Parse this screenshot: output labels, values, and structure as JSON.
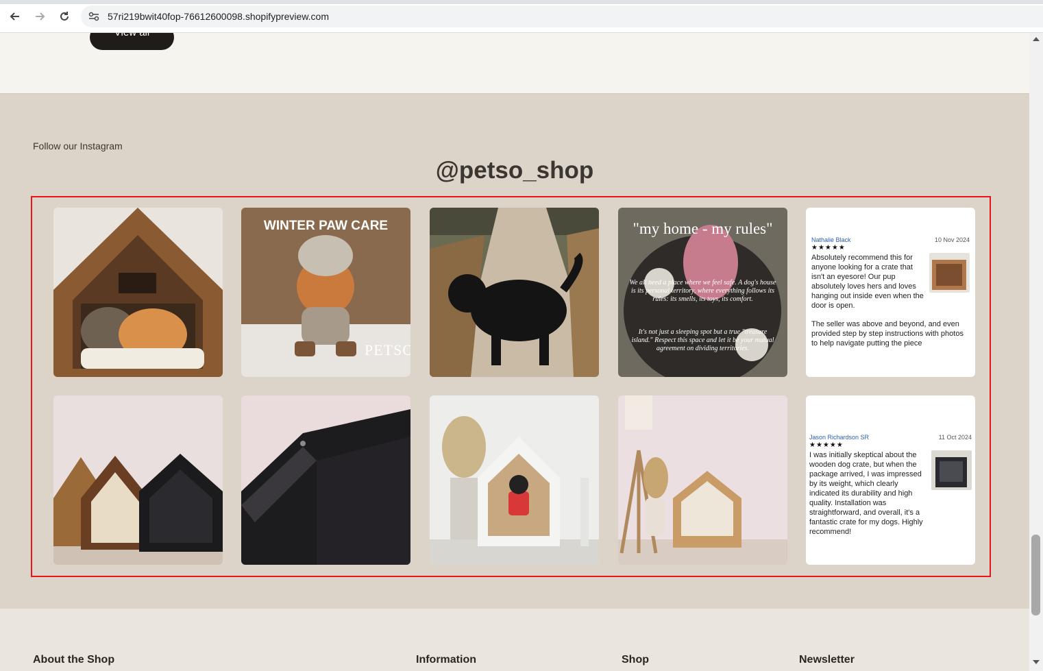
{
  "browser": {
    "url": "57ri219bwit40fop-76612600098.shopifypreview.com"
  },
  "top": {
    "view_all_label": "View all"
  },
  "instagram": {
    "kicker": "Follow our Instagram",
    "handle": "@petso_shop",
    "tiles": [
      {
        "id": "cats-in-house",
        "caption": ""
      },
      {
        "id": "winter-paw-care",
        "caption": "WINTER PAW CARE",
        "watermark": "PETSO"
      },
      {
        "id": "black-dog-path",
        "caption": ""
      },
      {
        "id": "my-home-my-rules",
        "caption": "\"my home - my rules\"",
        "para1": "We all need a place where we feel safe. A dog's house is its personal territory, where everything follows its rules: its smells, its toys, its comfort.",
        "para2": "It's not just a sleeping spot but a true \"treasure island.\" Respect this space and let it be your mutual agreement on dividing territories."
      },
      {
        "id": "houses-trio",
        "caption": ""
      },
      {
        "id": "black-house-closeup",
        "caption": ""
      },
      {
        "id": "white-crate-pug",
        "caption": ""
      },
      {
        "id": "natural-crate-room",
        "caption": ""
      }
    ],
    "reviews": [
      {
        "name": "Nathalie Black",
        "date": "10 Nov 2024",
        "stars": "★★★★★",
        "text": "Absolutely recommend this for anyone looking for a crate that isn't an eyesore! Our pup absolutely loves hers and loves hanging out inside even when the door is open.",
        "more": "The seller was above and beyond, and even provided step by step instructions with photos to help navigate putting the piece"
      },
      {
        "name": "Jason Richardson SR",
        "date": "11 Oct 2024",
        "stars": "★★★★★",
        "text": "I was initially skeptical about the wooden dog crate, but when the package arrived, I was impressed by its weight, which clearly indicated its durability and high quality. Installation was straightforward, and overall, it's a fantastic crate for my dogs. Highly recommend!",
        "more": ""
      }
    ]
  },
  "footer": {
    "headings": [
      "About the Shop",
      "Information",
      "Shop",
      "Newsletter"
    ]
  }
}
